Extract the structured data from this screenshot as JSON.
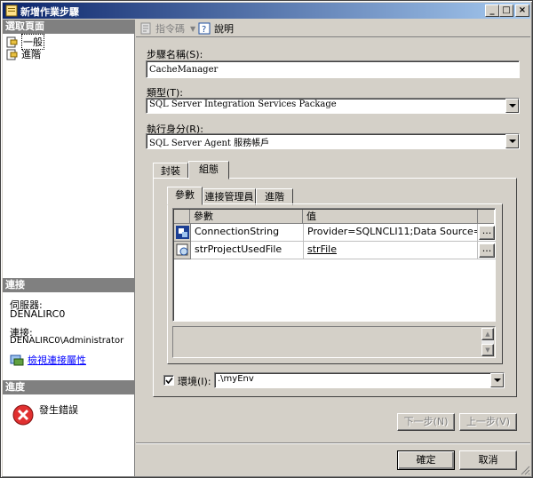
{
  "window": {
    "title": "新增作業步驟"
  },
  "titlebar_buttons": {
    "minimize": "_",
    "maximize": "□",
    "close": "×"
  },
  "left_panel": {
    "select_page_header": "選取頁面",
    "pages": [
      {
        "label": "一般",
        "icon": "page-icon"
      },
      {
        "label": "進階",
        "icon": "page-icon"
      }
    ],
    "connection_header": "連接",
    "server_label": "伺服器:",
    "server_value": "DENALIRC0",
    "connection_label": "連接:",
    "connection_value": "DENALIRC0\\Administrator",
    "view_connection_link": "檢視連接屬性",
    "progress_header": "進度",
    "progress_status": "發生錯誤"
  },
  "toolbar": {
    "script_label": "指令碼",
    "help_label": "說明"
  },
  "form": {
    "step_name_label": "步驟名稱(S):",
    "step_name_value": "CacheManager",
    "type_label": "類型(T):",
    "type_value": "SQL Server Integration Services Package",
    "run_as_label": "執行身分(R):",
    "run_as_value": "SQL Server Agent 服務帳戶"
  },
  "outer_tabs": [
    "封裝",
    "組態"
  ],
  "inner_tabs": [
    "參數",
    "連接管理員",
    "進階"
  ],
  "param_grid": {
    "columns": [
      "參數",
      "值"
    ],
    "rows": [
      {
        "name": "ConnectionString",
        "value": "Provider=SQLNCLI11;Data Source=.;Initial C...",
        "button": "..."
      },
      {
        "name": "strProjectUsedFile",
        "value": "strFile",
        "button": "..."
      }
    ]
  },
  "environment": {
    "checked": true,
    "label": "環境(I):",
    "value": ".\\myEnv"
  },
  "nav_buttons": {
    "next": "下一步(N)",
    "prev": "上一步(V)"
  },
  "dialog_buttons": {
    "ok": "確定",
    "cancel": "取消"
  }
}
